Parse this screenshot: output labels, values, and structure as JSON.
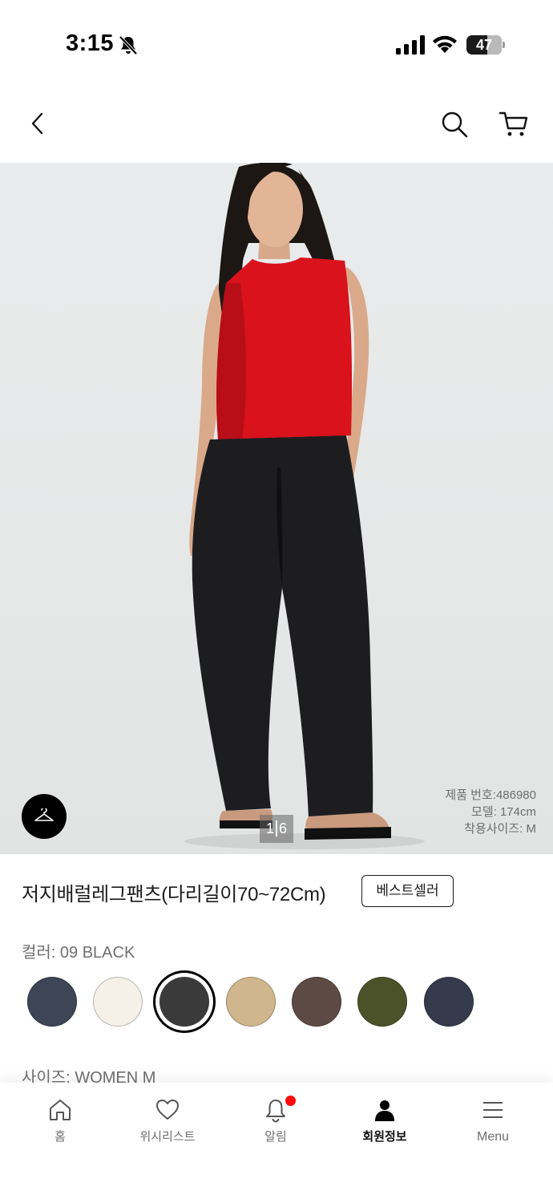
{
  "status_bar": {
    "time": "3:15",
    "battery_level": "47"
  },
  "header": {
    "back_icon": "chevron-left-icon",
    "search_icon": "search-icon",
    "cart_icon": "cart-icon"
  },
  "gallery": {
    "current_page": "1",
    "total_pages": "6",
    "product_number": "제품 번호:486980",
    "model_height": "모델: 174cm",
    "worn_size": "착용사이즈: M"
  },
  "product": {
    "title": "저지배럴레그팬츠(다리길이70~72Cm)",
    "badge": "베스트셀러",
    "color_label": "컬러: 09 BLACK",
    "size_label": "사이즈: WOMEN M",
    "colors": [
      {
        "hex": "#3d4556",
        "selected": false
      },
      {
        "hex": "#f5f1e8",
        "selected": false
      },
      {
        "hex": "#3a3a3a",
        "selected": true
      },
      {
        "hex": "#cfb68c",
        "selected": false
      },
      {
        "hex": "#5e4a44",
        "selected": false
      },
      {
        "hex": "#4b5229",
        "selected": false
      },
      {
        "hex": "#353b4d",
        "selected": false
      }
    ]
  },
  "bottom_nav": {
    "items": [
      {
        "label": "홈",
        "icon": "home-icon",
        "active": false
      },
      {
        "label": "위시리스트",
        "icon": "heart-icon",
        "active": false
      },
      {
        "label": "알림",
        "icon": "bell-icon",
        "active": false,
        "has_badge": true
      },
      {
        "label": "회원정보",
        "icon": "user-icon",
        "active": true
      },
      {
        "label": "Menu",
        "icon": "menu-icon",
        "active": false
      }
    ]
  },
  "colors": {
    "accent_red": "#ff0a0a",
    "text": "#1b1b1b"
  }
}
